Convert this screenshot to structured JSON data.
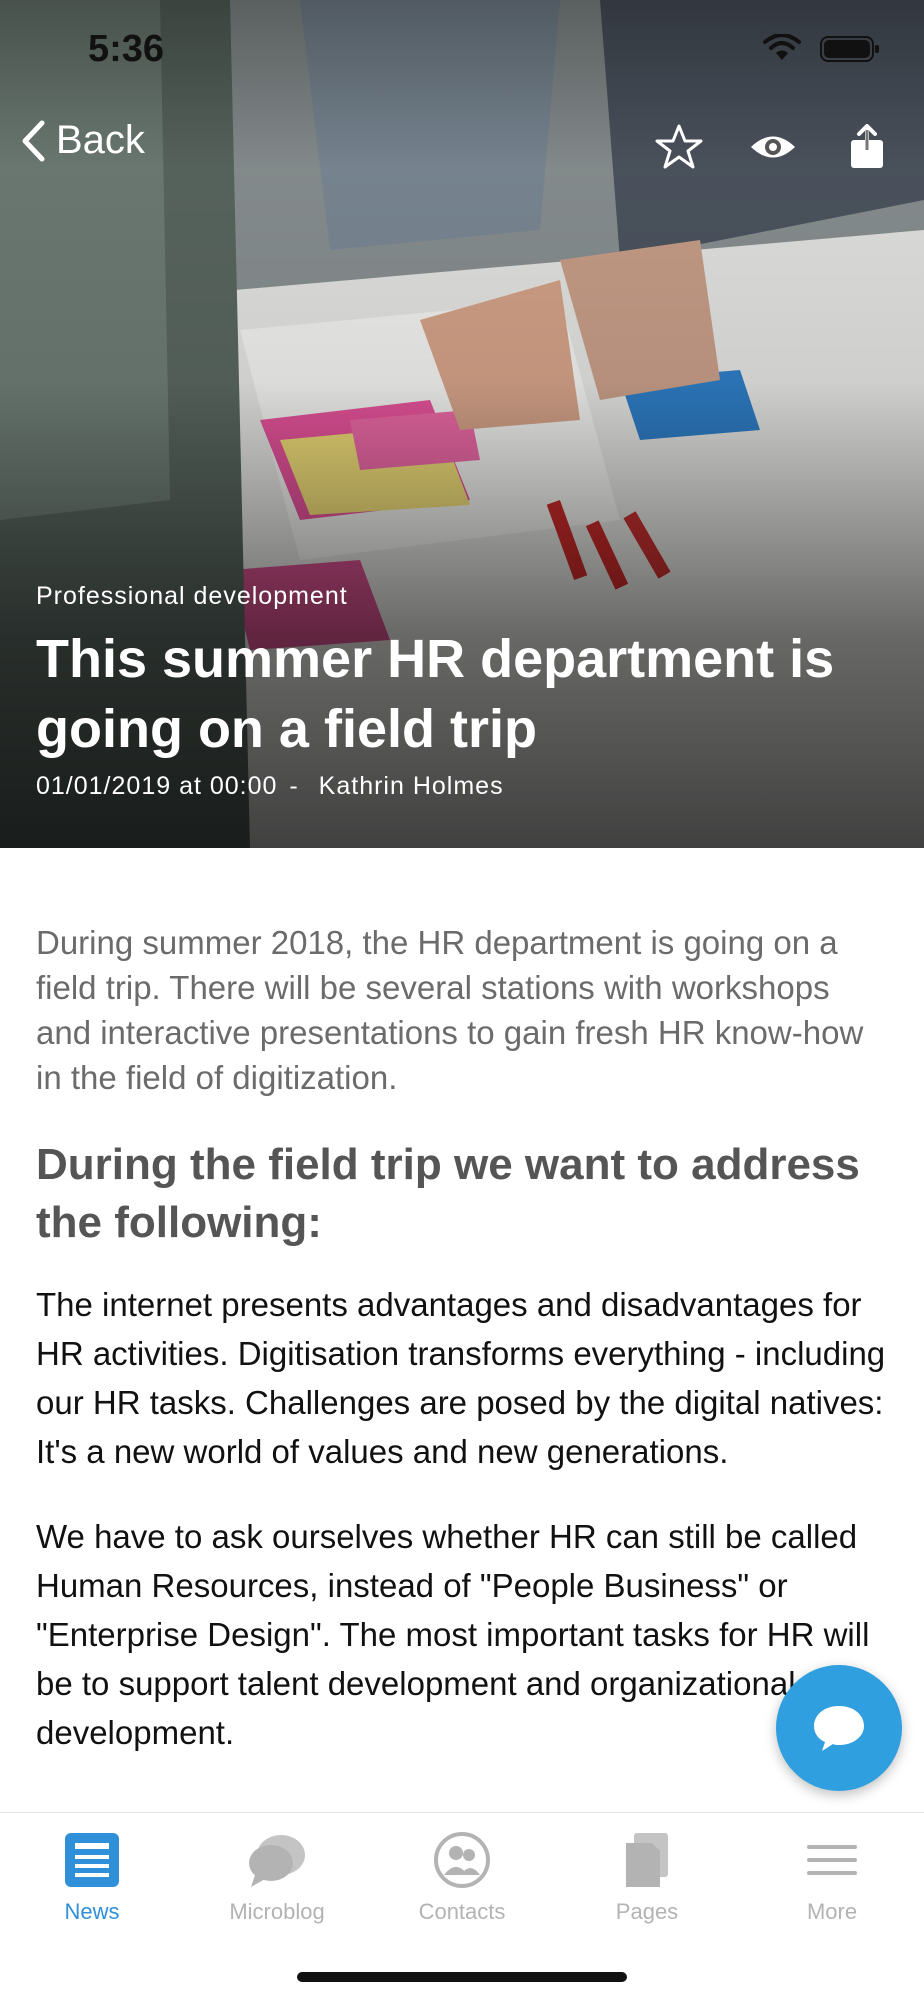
{
  "status_bar": {
    "time": "5:36",
    "icons": [
      "wifi-icon",
      "battery-icon"
    ]
  },
  "nav": {
    "back_label": "Back",
    "actions": [
      "star-icon",
      "eye-icon",
      "share-icon"
    ]
  },
  "article": {
    "category": "Professional development",
    "title": "This summer HR department is going on a field trip",
    "date": "01/01/2019 at 00:00",
    "separator": "-",
    "author": "Kathrin Holmes",
    "lead": "During summer 2018, the HR department is going on a field trip. There will be several stations with workshops and interactive presentations to gain fresh HR know-how in the field of digitization.",
    "subheading": "During the field trip we want to address the following:",
    "paragraphs": [
      "The internet presents advantages and disadvantages for HR activities. Digitisation transforms everything - including our HR tasks. Challenges are posed by the digital natives: It's a new world of values and new generations.",
      "We have to ask ourselves whether HR can still be called Human Resources, instead of \"People Business\" or \"Enterprise Design\". The most important tasks for HR will be to support talent development and organizational development."
    ]
  },
  "fab": {
    "icon": "chat-bubble-icon"
  },
  "tabbar": {
    "active": "News",
    "items": [
      {
        "label": "News",
        "icon": "news-icon"
      },
      {
        "label": "Microblog",
        "icon": "microblog-icon"
      },
      {
        "label": "Contacts",
        "icon": "contacts-icon"
      },
      {
        "label": "Pages",
        "icon": "pages-icon"
      },
      {
        "label": "More",
        "icon": "menu-icon"
      }
    ]
  },
  "colors": {
    "accent": "#2f9fe0",
    "tab_active": "#2f8fd8",
    "tab_inactive": "#b3b3b3",
    "lead_text": "#6b6b6b",
    "body_text": "#111111"
  }
}
